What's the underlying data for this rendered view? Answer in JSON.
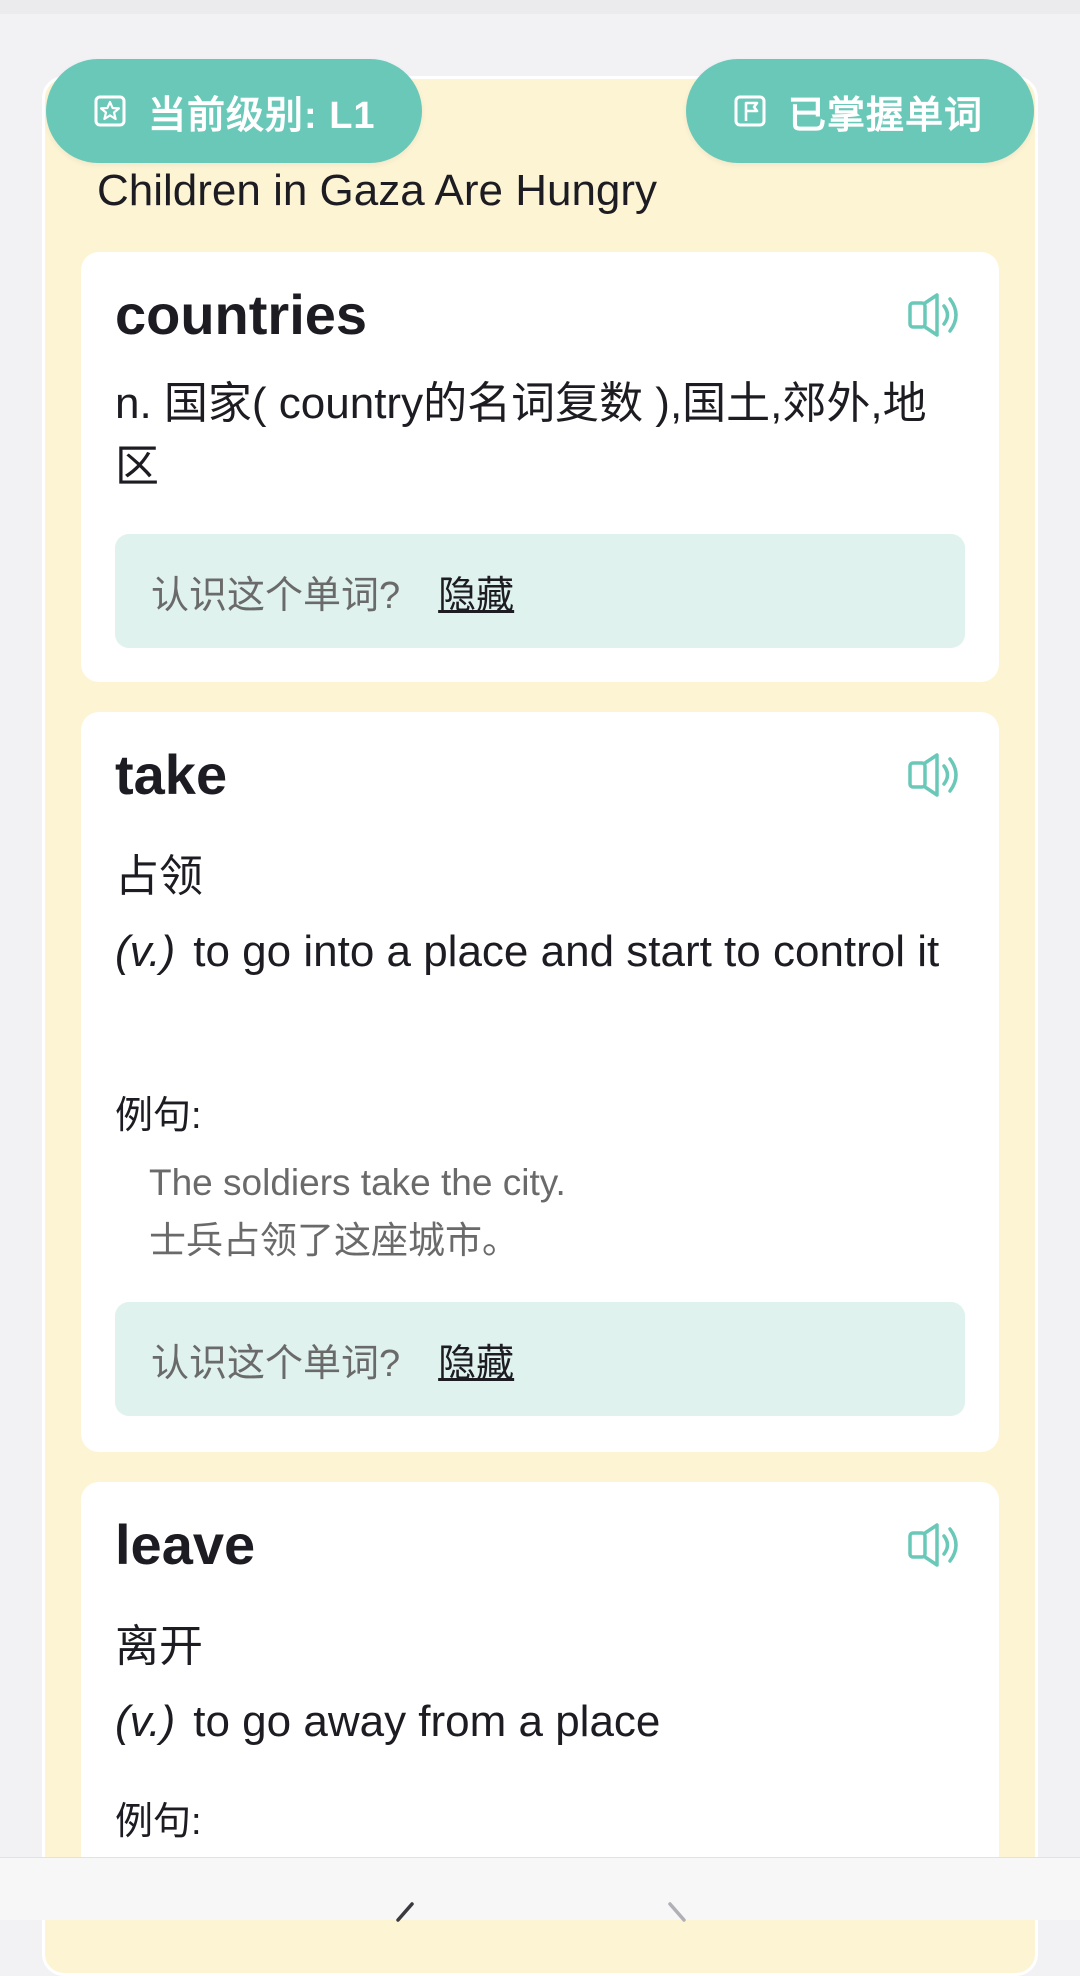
{
  "header": {
    "level_label": "当前级别: L1",
    "known_words_label": "已掌握单词"
  },
  "article": {
    "title": "Children in Gaza Are Hungry"
  },
  "cards": [
    {
      "word": "countries",
      "definition": "n. 国家( country的名词复数 ),国土,郊外,地区",
      "know_prompt": "认识这个单词?",
      "hide_label": "隐藏"
    },
    {
      "word": "take",
      "chinese": "占领",
      "pos": "(v.)",
      "english_def": "to go into a place and start to control it",
      "example_label": "例句:",
      "example_en": "The soldiers take the city.",
      "example_cn": "士兵占领了这座城市。",
      "know_prompt": "认识这个单词?",
      "hide_label": "隐藏"
    },
    {
      "word": "leave",
      "chinese": "离开",
      "pos": "(v.)",
      "english_def": "to go away from a place",
      "example_label": "例句:"
    }
  ],
  "icons": {
    "level": "star-badge-icon",
    "known": "bookmark-flag-icon",
    "speaker": "speaker-icon",
    "back": "chevron-left-icon",
    "forward": "chevron-right-icon"
  },
  "colors": {
    "accent": "#6ac8b8",
    "panel_bg": "#fdf4d4",
    "know_bar_bg": "#dff2ee"
  }
}
